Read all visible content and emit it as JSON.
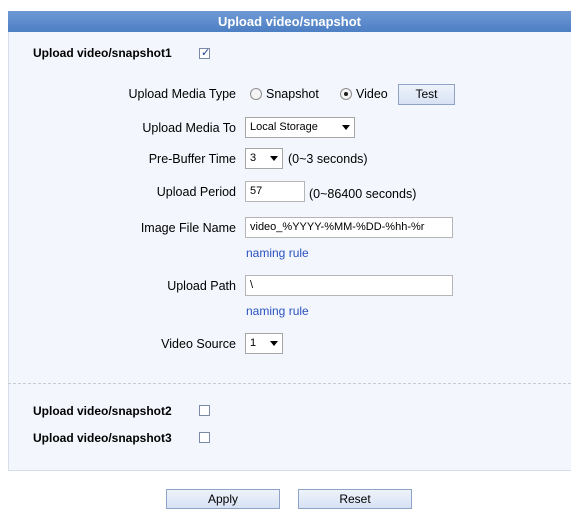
{
  "header": {
    "title": "Upload video/snapshot"
  },
  "snapshot1": {
    "label": "Upload video/snapshot1",
    "checked": true
  },
  "form": {
    "media_type": {
      "label": "Upload Media Type",
      "option_snapshot": "Snapshot",
      "option_video": "Video",
      "selected": "Video",
      "test_label": "Test"
    },
    "media_to": {
      "label": "Upload Media To",
      "value": "Local Storage"
    },
    "prebuffer": {
      "label": "Pre-Buffer Time",
      "value": "3",
      "hint": "(0~3 seconds)"
    },
    "period": {
      "label": "Upload Period",
      "value": "57",
      "hint": "(0~86400 seconds)"
    },
    "image_name": {
      "label": "Image File Name",
      "value": "video_%YYYY-%MM-%DD-%hh-%r",
      "rule_link": "naming rule"
    },
    "path": {
      "label": "Upload Path",
      "value": "\\",
      "rule_link": "naming rule"
    },
    "video_source": {
      "label": "Video Source",
      "value": "1"
    }
  },
  "snapshot2": {
    "label": "Upload video/snapshot2",
    "checked": false
  },
  "snapshot3": {
    "label": "Upload video/snapshot3",
    "checked": false
  },
  "footer": {
    "apply_label": "Apply",
    "reset_label": "Reset"
  }
}
